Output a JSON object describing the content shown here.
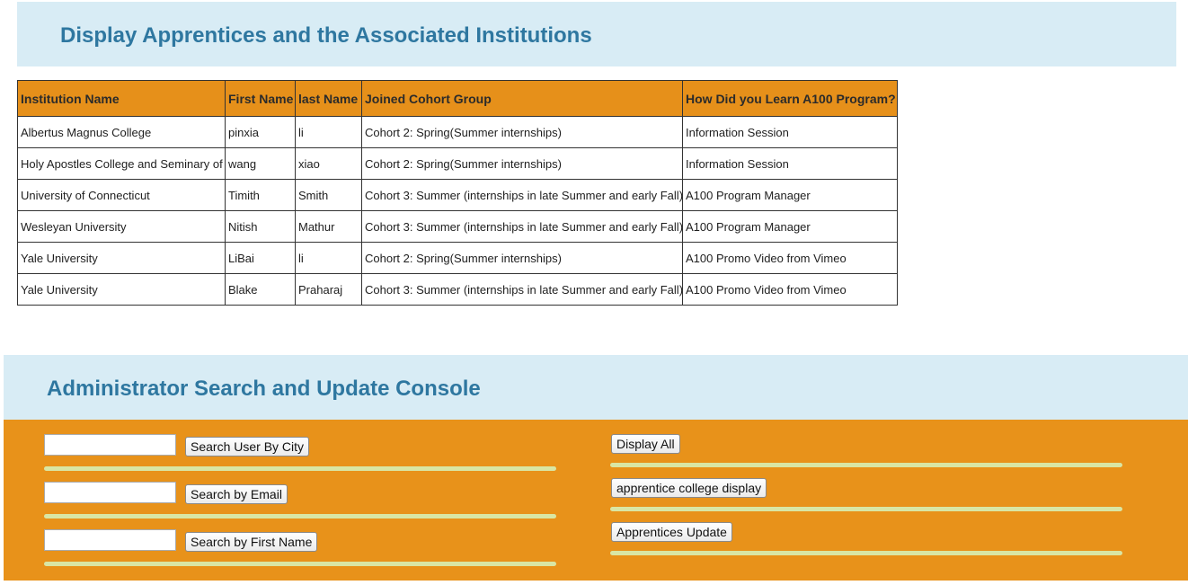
{
  "display_section": {
    "title": "Display Apprentices and the Associated Institutions"
  },
  "table": {
    "headers": [
      "Institution Name",
      "First Name",
      "last Name",
      "Joined Cohort Group",
      "How Did you Learn A100 Program?"
    ],
    "rows": [
      [
        "Albertus Magnus College",
        "pinxia",
        "li",
        "Cohort 2: Spring(Summer internships)",
        "Information Session"
      ],
      [
        "Holy Apostles College and Seminary of",
        "wang",
        "xiao",
        "Cohort 2: Spring(Summer internships)",
        "Information Session"
      ],
      [
        "University of Connecticut",
        "Timith",
        "Smith",
        "Cohort 3: Summer (internships in late Summer and early Fall)",
        "A100 Program Manager"
      ],
      [
        "Wesleyan University",
        "Nitish",
        "Mathur",
        "Cohort 3: Summer (internships in late Summer and early Fall)",
        "A100 Program Manager"
      ],
      [
        "Yale University",
        "LiBai",
        "li",
        "Cohort 2: Spring(Summer internships)",
        "A100 Promo Video from Vimeo"
      ],
      [
        "Yale University",
        "Blake",
        "Praharaj",
        "Cohort 3: Summer (internships in late Summer and early Fall)",
        "A100 Promo Video from Vimeo"
      ]
    ]
  },
  "admin_section": {
    "title": "Administrator Search and Update Console",
    "city_input_value": "",
    "email_input_value": "",
    "first_name_input_value": "",
    "search_city_label": "Search User By City",
    "search_email_label": "Search by Email",
    "search_first_name_label": "Search by First Name",
    "display_all_label": "Display All",
    "college_display_label": "apprentice college display",
    "update_label": "Apprentices Update"
  },
  "colors": {
    "header_bg": "#d8ecf5",
    "title_text": "#2e77a0",
    "table_header_bg": "#e6901a",
    "admin_panel_bg": "#e8921a",
    "divider": "#d9e6a4"
  }
}
